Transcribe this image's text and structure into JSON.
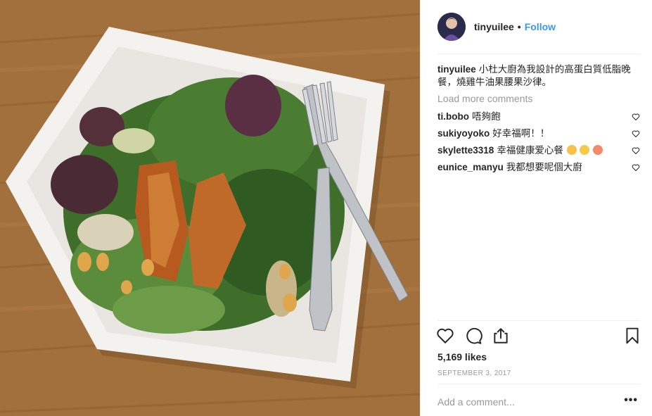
{
  "post": {
    "username": "tinyuilee",
    "follow_label": "Follow",
    "caption": "小杜大廚為我設計的高蛋白質低脂晚餐，燒雞牛油果腰果沙律。",
    "load_more_label": "Load more comments",
    "comments": [
      {
        "user": "ti.bobo",
        "text": "唔夠飽"
      },
      {
        "user": "sukiyoyoko",
        "text": "好幸福啊！！"
      },
      {
        "user": "skylette3318",
        "text": "幸福健康爱心餐"
      },
      {
        "user": "eunice_manyu",
        "text": "我都想要呢個大廚"
      }
    ],
    "likes": "5,169 likes",
    "date": "SEPTEMBER 3, 2017",
    "add_comment_placeholder": "Add a comment...",
    "more_label": "•••"
  },
  "icons": {
    "like": "heart-icon",
    "comment": "comment-icon",
    "share": "share-icon",
    "save": "bookmark-icon",
    "more": "more-icon"
  },
  "colors": {
    "link_blue": "#3897f0",
    "muted_text": "#999999",
    "divider": "#efefef",
    "text": "#262626"
  }
}
